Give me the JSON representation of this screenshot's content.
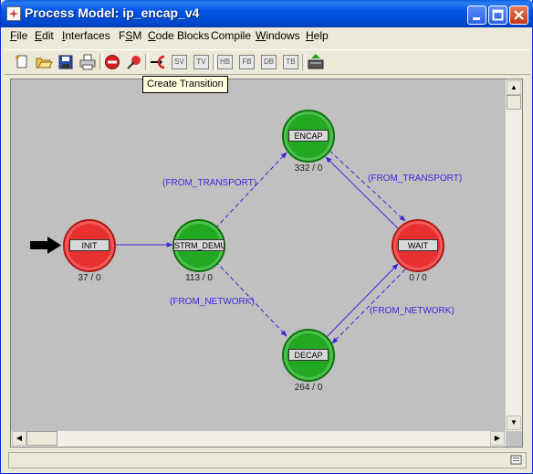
{
  "window": {
    "title": "Process Model: ip_encap_v4"
  },
  "menu": [
    "File",
    "Edit",
    "Interfaces",
    "FSM",
    "Code Blocks",
    "Compile",
    "Windows",
    "Help"
  ],
  "menu_underline": [
    "F",
    "E",
    "I",
    "S",
    "C",
    "C",
    "W",
    "H"
  ],
  "tooltip": "Create Transition",
  "toolbar": {
    "text_buttons": [
      "SV",
      "TV",
      "HB",
      "FB",
      "DB",
      "TB"
    ]
  },
  "states": {
    "init": {
      "name": "INIT",
      "counts": "37 / 0",
      "color": "#e83030"
    },
    "strm": {
      "name": "STRM_DEMUX",
      "counts": "113 / 0",
      "color": "#22a822"
    },
    "encap": {
      "name": "ENCAP",
      "counts": "332 / 0",
      "color": "#22a822"
    },
    "decap": {
      "name": "DECAP",
      "counts": "264 / 0",
      "color": "#22a822"
    },
    "wait": {
      "name": "WAIT",
      "counts": "0 / 0",
      "color": "#e83030"
    }
  },
  "transitions": {
    "strm_encap": "(FROM_TRANSPORT)",
    "encap_wait": "(FROM_TRANSPORT)",
    "strm_decap": "(FROM_NETWORK)",
    "decap_wait": "(FROM_NETWORK)"
  },
  "colors": {
    "edge": "#3c28d8",
    "canvas": "#c0c0c0"
  }
}
